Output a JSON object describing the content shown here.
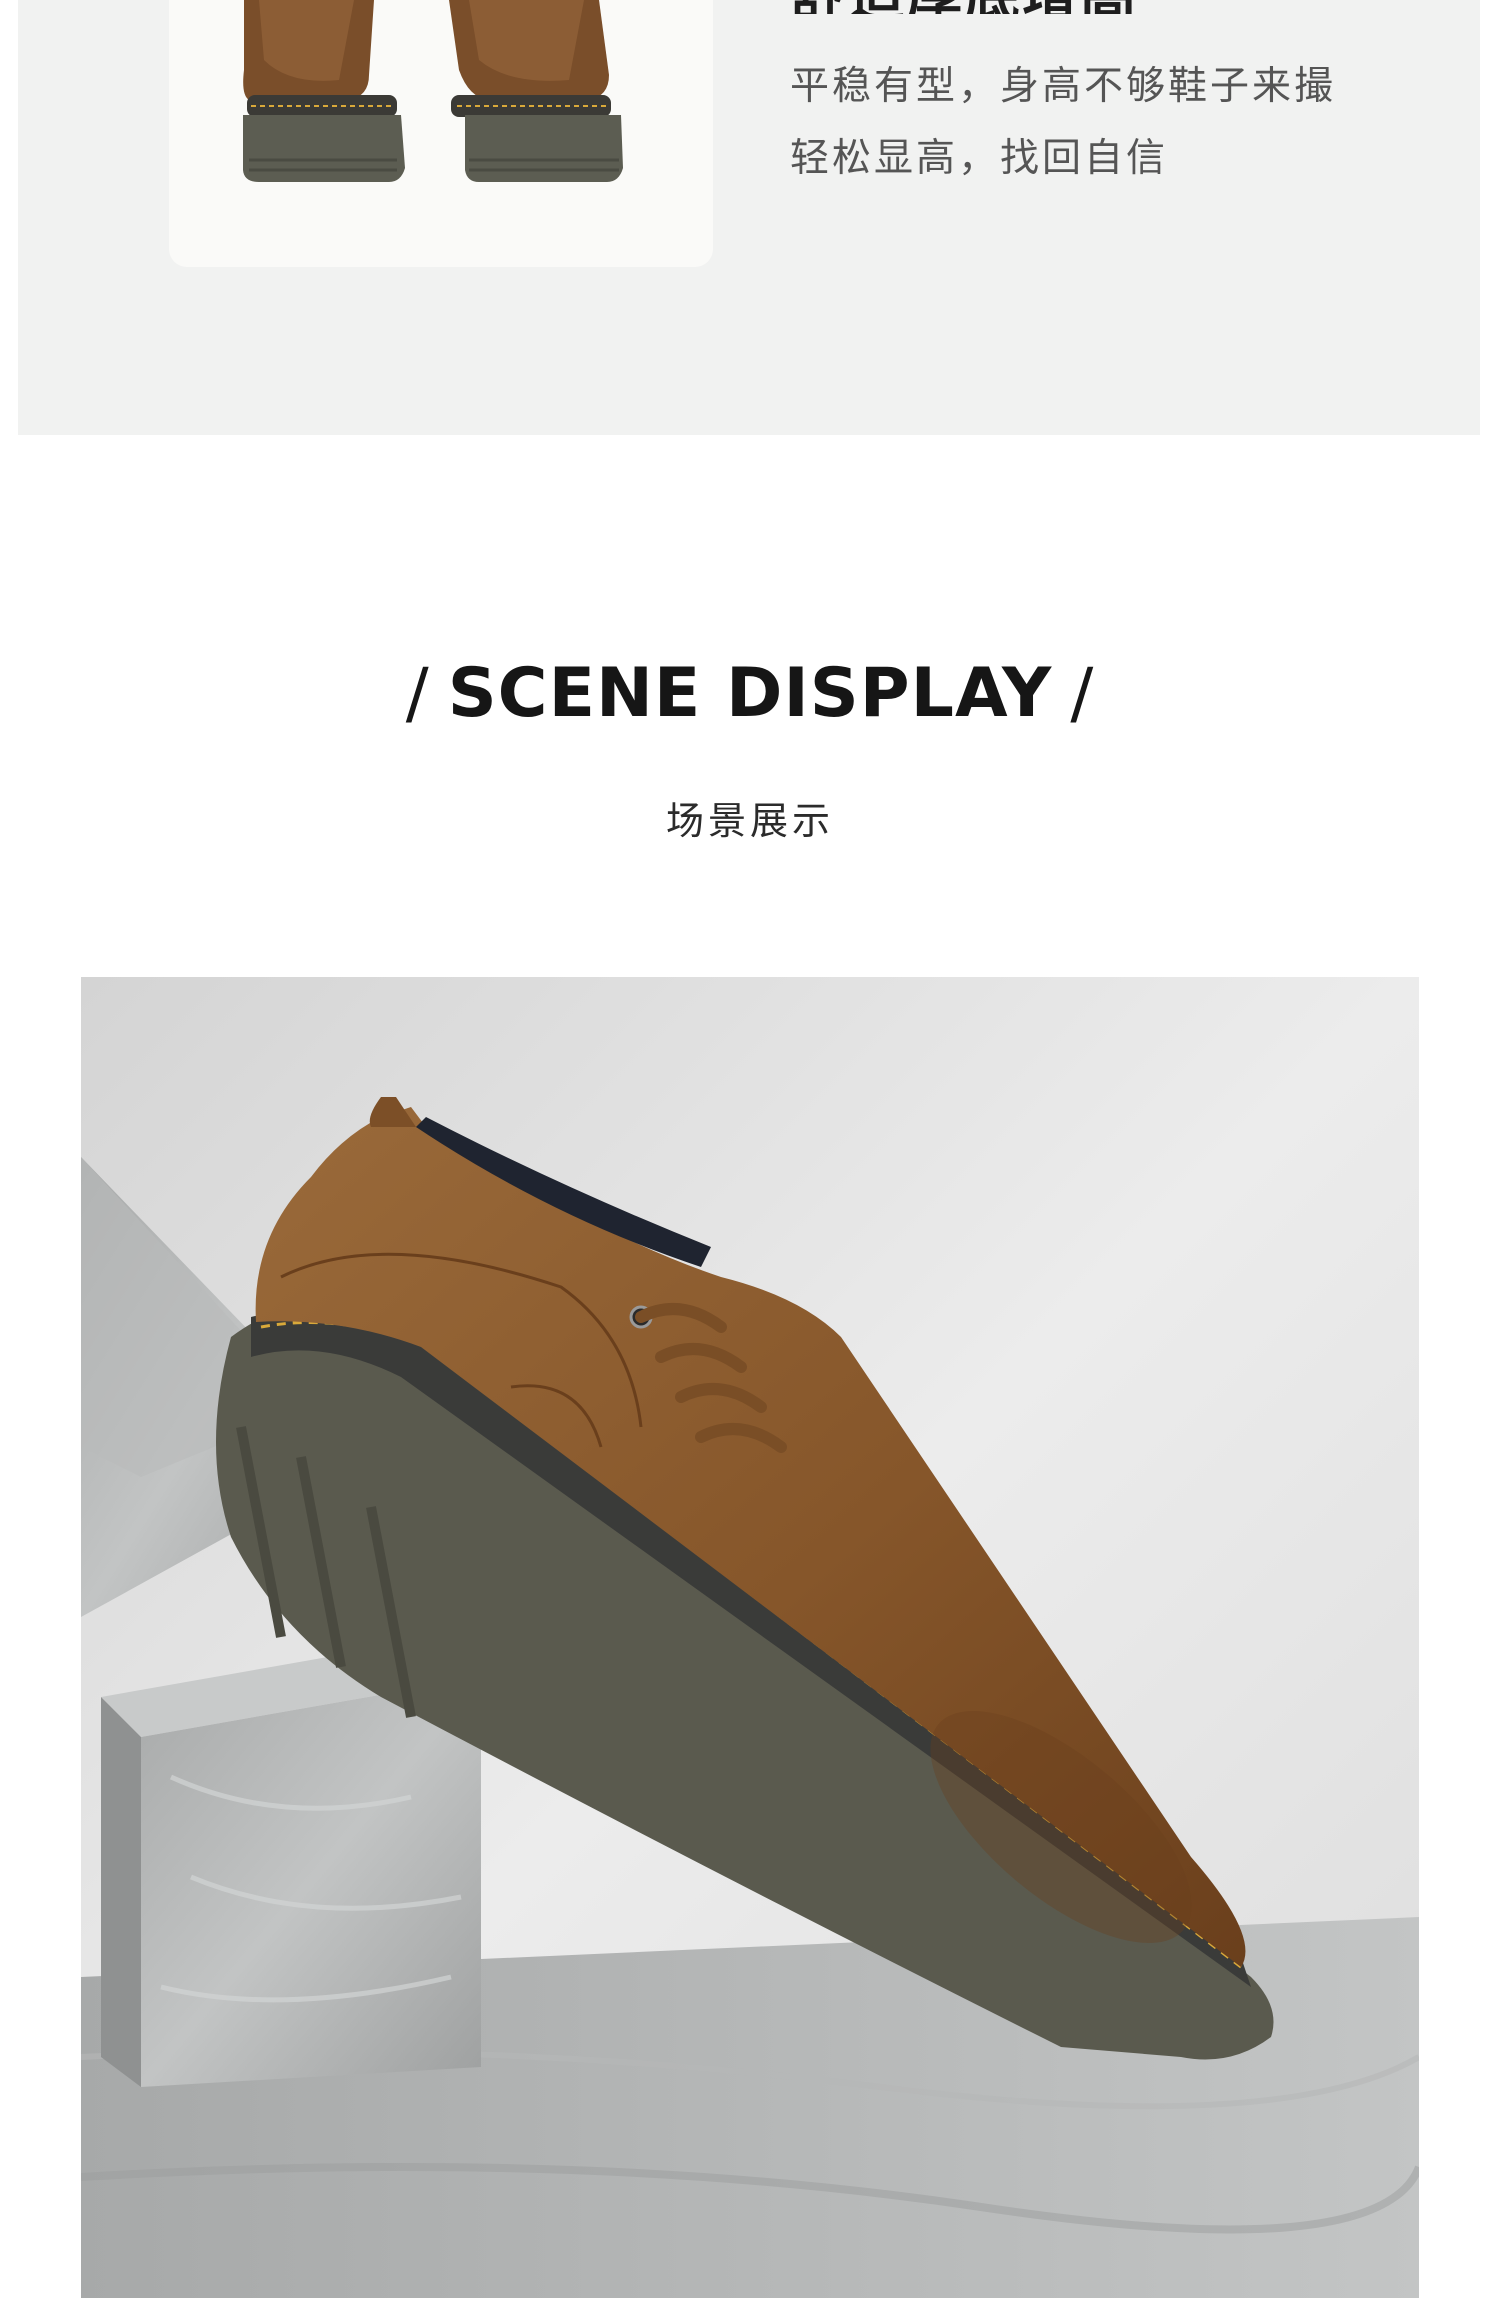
{
  "feature": {
    "heading": "舒适厚底增高",
    "lines": [
      "平稳有型，身高不够鞋子来撮",
      "轻松显高，找回自信"
    ]
  },
  "scene_section": {
    "title": "SCENE DISPLAY",
    "slash_left": "/",
    "slash_right": "/",
    "subtitle": "场景展示"
  },
  "images": {
    "top_shoes": "brown-derby-shoes-pair-soles",
    "scene_photo": "brown-leather-derby-shoe-on-marble-blocks"
  },
  "colors": {
    "panel_bg": "#f1f2f1",
    "leather": "#8a5a2e",
    "sole": "#5c5c52",
    "stitch": "#d9a93a",
    "title": "#161616"
  }
}
